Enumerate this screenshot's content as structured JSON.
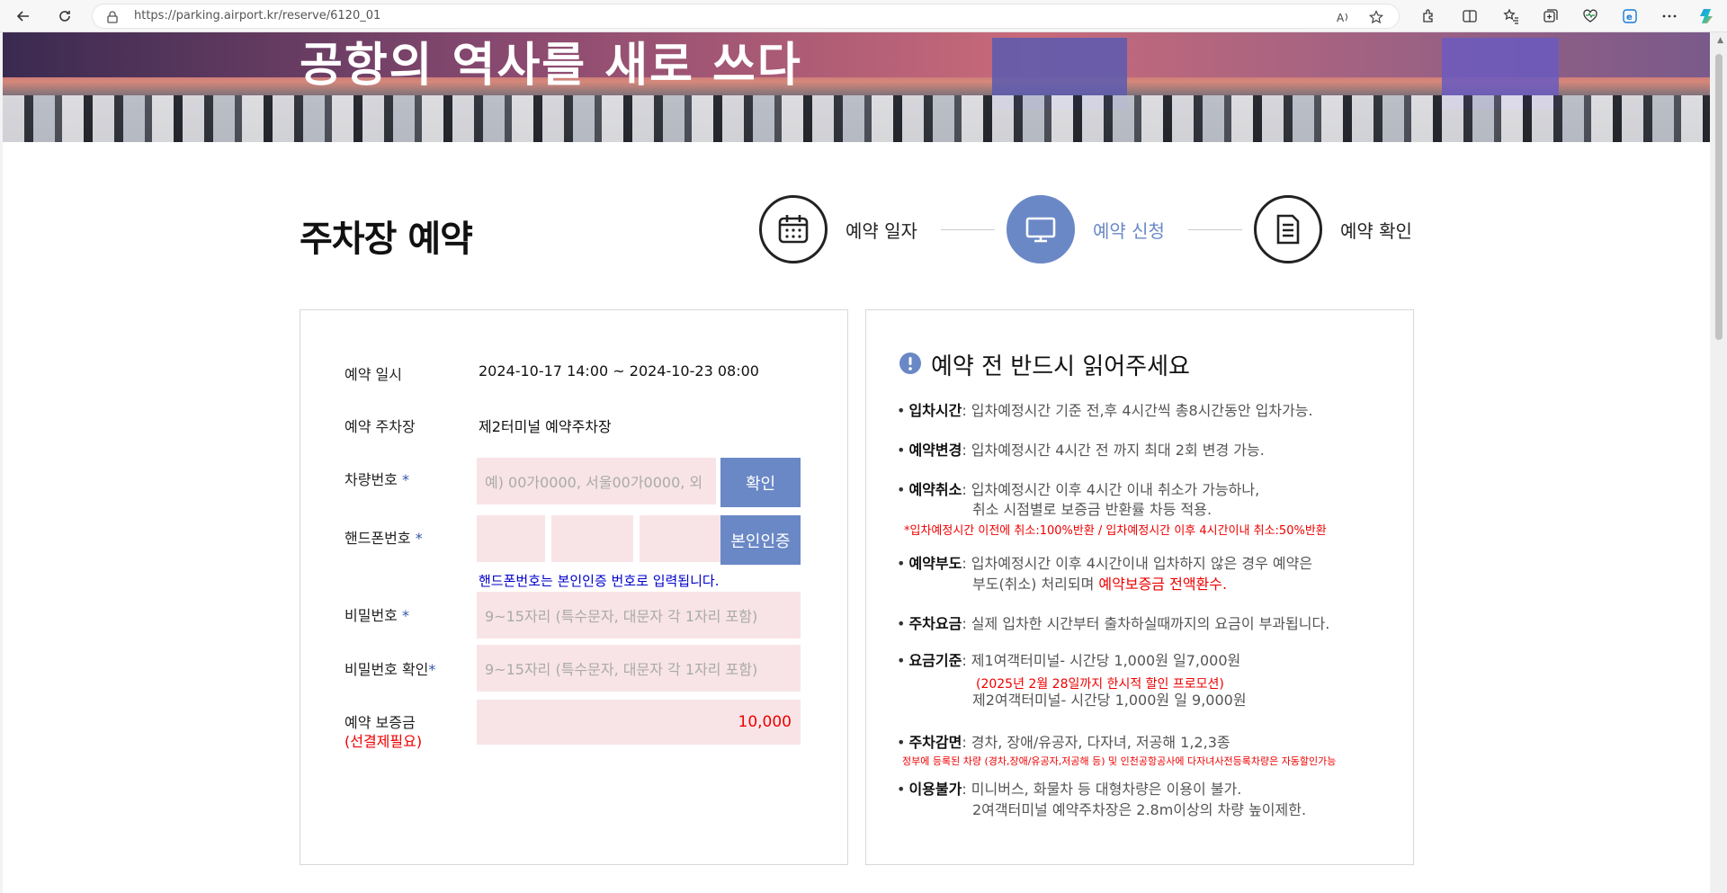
{
  "browser": {
    "url": "https://parking.airport.kr/reserve/6120_01"
  },
  "hero": {
    "title": "공항의 역사를 새로 쓰다"
  },
  "page": {
    "title": "주차장 예약"
  },
  "steps": [
    {
      "label": "예약 일자",
      "icon": "calendar-icon",
      "active": false
    },
    {
      "label": "예약 신청",
      "icon": "monitor-icon",
      "active": true
    },
    {
      "label": "예약 확인",
      "icon": "document-icon",
      "active": false
    }
  ],
  "form": {
    "reserve_datetime_label": "예약 일시",
    "reserve_datetime_value": "2024-10-17 14:00 ~ 2024-10-23 08:00",
    "parking_lot_label": "예약 주차장",
    "parking_lot_value": "제2터미널 예약주차장",
    "car_number_label": "차량번호",
    "car_number_placeholder": "예) 00가0000, 서울00가0000, 외",
    "confirm_button": "확인",
    "phone_label": "핸드폰번호",
    "verify_button": "본인인증",
    "phone_note": "핸드폰번호는 본인인증 번호로 입력됩니다.",
    "password_label": "비밀번호",
    "password_placeholder": "9~15자리 (특수문자, 대문자 각 1자리 포함)",
    "password_confirm_label": "비밀번호 확인",
    "password_confirm_placeholder": "9~15자리 (특수문자, 대문자 각 1자리 포함)",
    "deposit_label": "예약 보증금",
    "deposit_sub": "(선결제필요)",
    "deposit_value": "10,000",
    "required_mark": "*"
  },
  "notice": {
    "title": "예약 전 반드시 읽어주세요",
    "items": {
      "entry_head": "입차시간",
      "entry_text": ": 입차예정시간 기준 전,후 4시간씩 총8시간동안 입차가능.",
      "change_head": "예약변경",
      "change_text": ": 입차예정시간 4시간 전 까지 최대 2회 변경 가능.",
      "cancel_head": "예약취소",
      "cancel_text1": ": 입차예정시간 이후 4시간 이내 취소가 가능하나,",
      "cancel_text2": "취소 시점별로 보증금 반환률 차등 적용.",
      "cancel_red": "*입차예정시간 이전에 취소:100%반환 / 입차예정시간 이후 4시간이내 취소:50%반환",
      "noshow_head": "예약부도",
      "noshow_text1": ": 입차예정시간 이후 4시간이내 입차하지 않은 경우 예약은",
      "noshow_text2a": "부도(취소) 처리되며 ",
      "noshow_text2b": "예약보증금 전액환수.",
      "fee_head": "주차요금",
      "fee_text": ": 실제 입차한 시간부터 출차하실때까지의 요금이 부과됩니다.",
      "standard_head": "요금기준",
      "standard_text1": ": 제1여객터미널- 시간당 1,000원 일7,000원",
      "standard_red": "(2025년 2월 28일까지 한시적 할인 프로모션)",
      "standard_text2": "제2여객터미널- 시간당 1,000원 일 9,000원",
      "discount_head": "주차감면",
      "discount_text": ": 경차, 장애/유공자, 다자녀, 저공해 1,2,3종",
      "discount_red": "정부에 등록된 차량 (경차,장애/유공자,저공해 등) 및 인천공항공사에 다자녀사전등록차량은 자동할인가능",
      "unavailable_head": "이용불가",
      "unavailable_text1": ": 미니버스, 화물차 등 대형차량은 이용이 불가.",
      "unavailable_text2": "2여객터미널 예약주차장은 2.8m이상의 차량 높이제한."
    }
  },
  "colors": {
    "accent": "#6a88c6",
    "input_bg": "#f8e4e6",
    "warning": "#ee0000",
    "note_blue": "#0000cc"
  }
}
